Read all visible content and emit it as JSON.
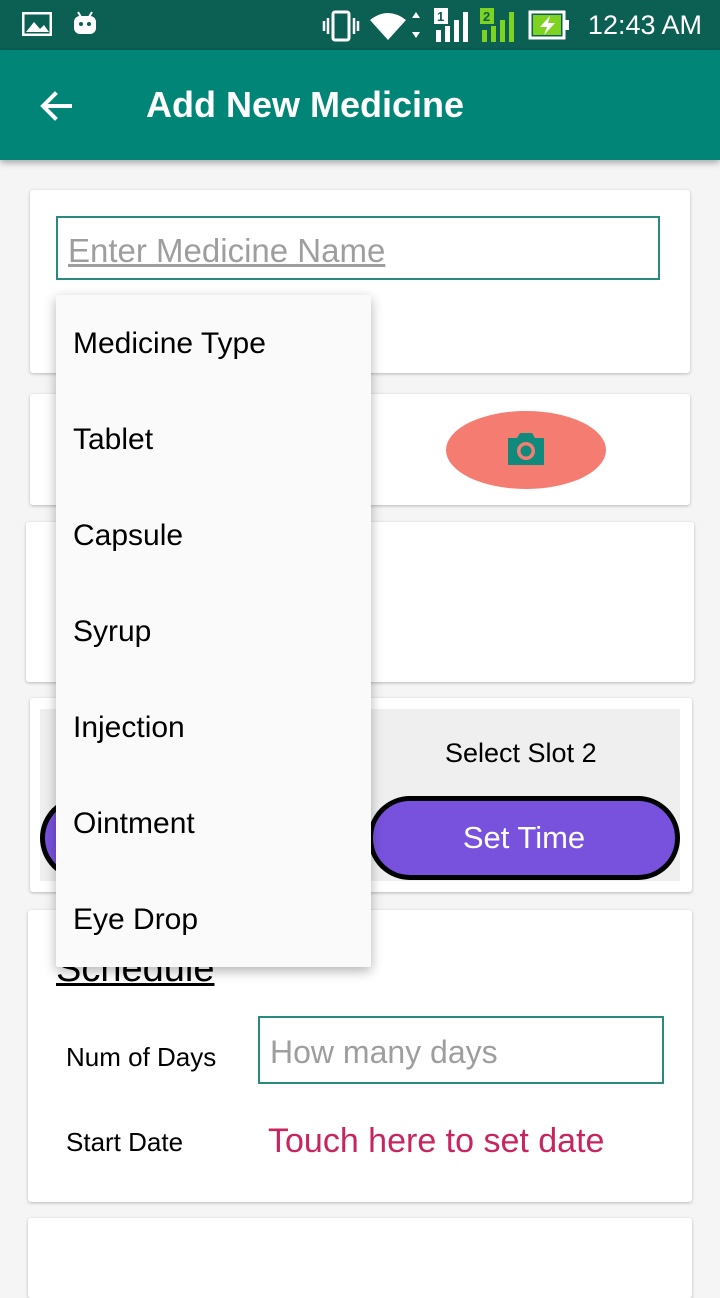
{
  "status_bar": {
    "time": "12:43 AM"
  },
  "app_bar": {
    "title": "Add New Medicine"
  },
  "medicine_name": {
    "placeholder": "Enter Medicine Name"
  },
  "medicine_type_menu": {
    "items": [
      "Medicine Type",
      "Tablet",
      "Capsule",
      "Syrup",
      "Injection",
      "Ointment",
      "Eye Drop"
    ]
  },
  "slots": {
    "slot2_label": "Select Slot 2",
    "set_time_label": "Set Time"
  },
  "schedule": {
    "title": "Schedule",
    "num_days_label": "Num of Days",
    "num_days_placeholder": "How many days",
    "start_date_label": "Start Date",
    "start_date_value": "Touch here to set date"
  },
  "colors": {
    "app_bar": "#008577",
    "status_bar": "#0b5f53",
    "camera_button": "#f47c70",
    "set_time_button": "#7852dc",
    "date_link": "#c8245f"
  }
}
